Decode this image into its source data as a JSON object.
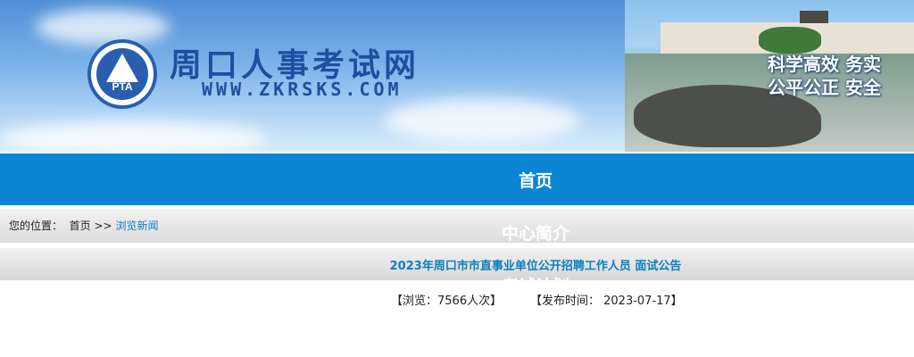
{
  "header": {
    "logo_text": "PTA",
    "site_name": "周口人事考试网",
    "site_url": "WWW.ZKRSKS.COM",
    "slogan_line1": "科学高效  务实",
    "slogan_line2": "公平公正  安全"
  },
  "nav": {
    "home": "首页",
    "about": "中心简介",
    "third": "考试计划"
  },
  "breadcrumb": {
    "prefix": "您的位置：",
    "home": "首页",
    "separator": ">>",
    "current": "浏览新闻"
  },
  "article": {
    "title": "2023年周口市市直事业单位公开招聘工作人员 面试公告",
    "views": "【浏览：7566人次】",
    "date": "【发布时间：  2023-07-17】"
  },
  "colors": {
    "nav_bg": "#0a86d4",
    "link": "#0b7fc0",
    "brand_blue": "#1f4f9e"
  }
}
